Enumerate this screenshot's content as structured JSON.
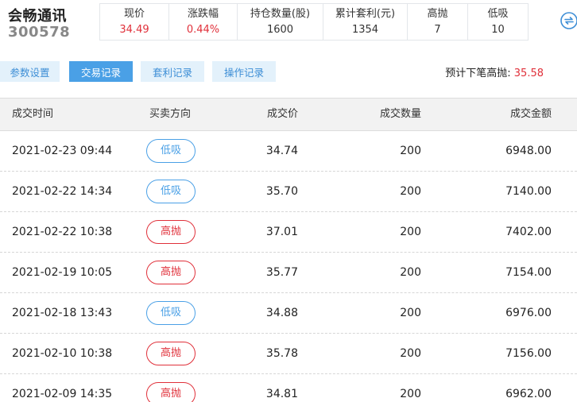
{
  "stock": {
    "name": "会畅通讯",
    "code": "300578"
  },
  "stats": [
    {
      "label": "现价",
      "value": "34.49",
      "red": true
    },
    {
      "label": "涨跌幅",
      "value": "0.44%",
      "red": true
    },
    {
      "label": "持仓数量(股)",
      "value": "1600",
      "red": false
    },
    {
      "label": "累计套利(元)",
      "value": "1354",
      "red": false
    },
    {
      "label": "高抛",
      "value": "7",
      "red": false
    },
    {
      "label": "低吸",
      "value": "10",
      "red": false
    }
  ],
  "tabs": [
    {
      "label": "参数设置",
      "active": false
    },
    {
      "label": "交易记录",
      "active": true
    },
    {
      "label": "套利记录",
      "active": false
    },
    {
      "label": "操作记录",
      "active": false
    }
  ],
  "forecast": {
    "label": "预计下笔高抛:",
    "value": "35.58"
  },
  "table": {
    "headers": [
      "成交时间",
      "买卖方向",
      "成交价",
      "成交数量",
      "成交金额"
    ],
    "rows": [
      {
        "time": "2021-02-23 09:44",
        "direction": "低吸",
        "type": "buy",
        "price": "34.74",
        "qty": "200",
        "amount": "6948.00"
      },
      {
        "time": "2021-02-22 14:34",
        "direction": "低吸",
        "type": "buy",
        "price": "35.70",
        "qty": "200",
        "amount": "7140.00"
      },
      {
        "time": "2021-02-22 10:38",
        "direction": "高抛",
        "type": "sell",
        "price": "37.01",
        "qty": "200",
        "amount": "7402.00"
      },
      {
        "time": "2021-02-19 10:05",
        "direction": "高抛",
        "type": "sell",
        "price": "35.77",
        "qty": "200",
        "amount": "7154.00"
      },
      {
        "time": "2021-02-18 13:43",
        "direction": "低吸",
        "type": "buy",
        "price": "34.88",
        "qty": "200",
        "amount": "6976.00"
      },
      {
        "time": "2021-02-10 10:38",
        "direction": "高抛",
        "type": "sell",
        "price": "35.78",
        "qty": "200",
        "amount": "7156.00"
      },
      {
        "time": "2021-02-09 14:35",
        "direction": "高抛",
        "type": "sell",
        "price": "34.81",
        "qty": "200",
        "amount": "6962.00"
      }
    ]
  },
  "colors": {
    "accent_blue": "#4aa0e6",
    "up_red": "#e0303a",
    "tab_bg": "#e3f1fb",
    "header_bg": "#f2f2f2"
  },
  "icons": {
    "refresh": "refresh-icon"
  }
}
